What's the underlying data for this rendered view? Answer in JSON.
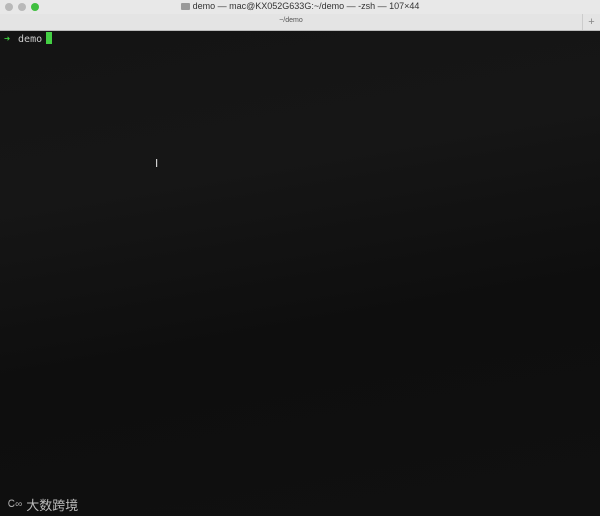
{
  "window": {
    "title": "demo — mac@KX052G633G:~/demo — -zsh — 107×44",
    "tab": "~/demo",
    "new_tab": "+"
  },
  "terminal": {
    "prompt_symbol": "➜",
    "directory": "demo"
  },
  "watermark": {
    "logo": "Ꮯ∞",
    "text": "大数跨境"
  }
}
